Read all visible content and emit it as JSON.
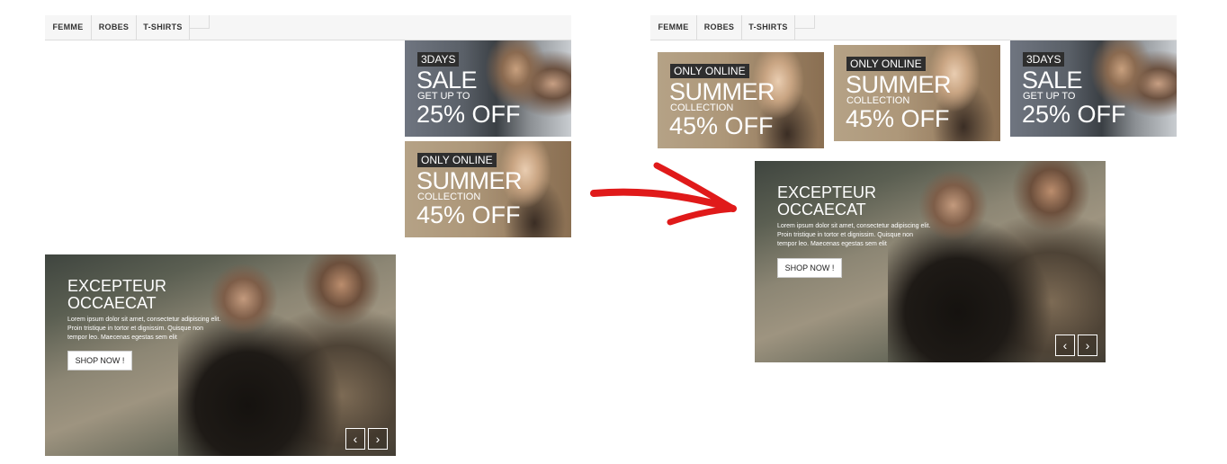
{
  "nav_tabs": [
    "FEMME",
    "ROBES",
    "T-SHIRTS"
  ],
  "banner_sale": {
    "badge": "3DAYS",
    "headline": "SALE",
    "sub": "GET UP TO",
    "offer": "25% OFF"
  },
  "banner_summer": {
    "badge": "ONLY ONLINE",
    "headline": "SUMMER",
    "sub": "COLLECTION",
    "offer": "45% OFF"
  },
  "slider": {
    "title_line1": "EXCEPTEUR",
    "title_line2": "OCCAECAT",
    "text": "Lorem ipsum dolor sit amet, consectetur adipiscing elit. Proin tristique in tortor et dignissim. Quisque non tempor leo. Maecenas egestas sem elit",
    "button": "SHOP NOW !",
    "prev_icon": "‹",
    "next_icon": "›"
  },
  "colors": {
    "arrow_annotation": "#e01a1a",
    "tab_bar": "#f6f6f6",
    "badge_bg": "#2e2e2e"
  }
}
